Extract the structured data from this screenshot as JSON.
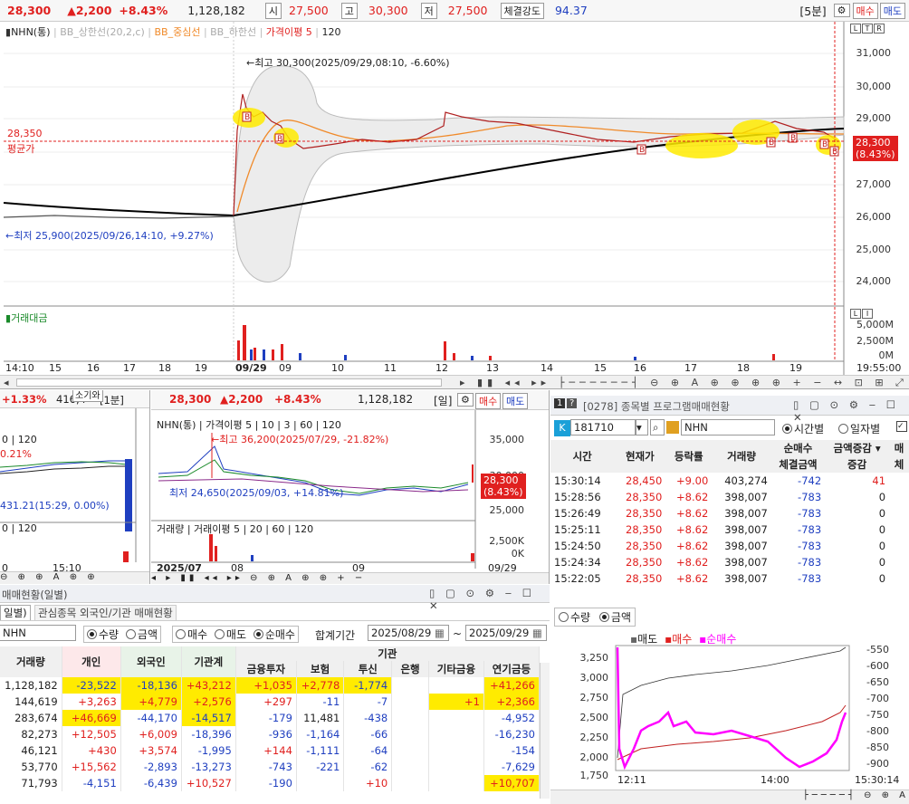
{
  "top": {
    "price": "28,300",
    "change": "▲2,200",
    "change_pct": "+8.43%",
    "volume": "1,128,182",
    "open_label": "시",
    "open": "27,500",
    "high_label": "고",
    "high": "30,300",
    "low_label": "저",
    "low": "27,500",
    "strength_label": "체결강도",
    "strength": "94.37",
    "interval": "[5분]",
    "buy": "매수",
    "sell": "매도",
    "legend": {
      "name": "NHN(통)",
      "bb_up": "BB_상한선(20,2,c)",
      "bb_mid": "BB_중심선",
      "bb_low": "BB_하한선",
      "disp": "가격이평 5",
      "n120": "120"
    },
    "max_note": "←최고 30,300(2025/09/29,08:10, -6.60%)",
    "min_note": "←최저 25,900(2025/09/26,14:10, +9.27%)",
    "avg_price": "28,350",
    "avg_label": "평균가",
    "price_tag": "28,300",
    "price_tag_pct": "(8.43%)",
    "y_ticks": [
      "31,000",
      "30,000",
      "29,000",
      "28,000",
      "27,000",
      "26,000",
      "25,000",
      "24,000"
    ],
    "vol_label": "거래대금",
    "vol_ticks": [
      "5,000M",
      "2,500M",
      "0M"
    ],
    "x_ticks": [
      "14:10",
      "15",
      "16",
      "17",
      "18",
      "19",
      "09/29",
      "09",
      "10",
      "11",
      "12",
      "13",
      "14",
      "15",
      "16",
      "17",
      "18",
      "19"
    ],
    "time": "19:55:00"
  },
  "left_mini": {
    "pct": "+1.33%",
    "val": "416,4",
    "interval": "[1분]",
    "legend": "0 | 120",
    "note": "431.21(15:29, 0.00%)",
    "legend2": "0 | 120",
    "x1": "0",
    "x2": "15:10",
    "cap": "소기와",
    "pct2": "0.21%"
  },
  "mid": {
    "price": "28,300",
    "change": "▲2,200",
    "change_pct": "+8.43%",
    "volume": "1,128,182",
    "interval": "[일]",
    "buy": "매수",
    "sell": "매도",
    "legend": "NHN(통) | 가격이평 5 | 10 | 3 | 60 | 120",
    "max_note": "←최고 36,200(2025/07/29, -21.82%)",
    "min_note": "최저 24,650(2025/09/03, +14.81%)",
    "y_ticks": [
      "35,000",
      "30,000",
      "25,000"
    ],
    "tag": "28,300",
    "tag_pct": "(8.43%)",
    "vol_legend": "거래량 | 거래이평 5 | 20 | 60 | 120",
    "vol_ticks": [
      "2,500K",
      "0K"
    ],
    "x_ticks": [
      "2025/07",
      "08",
      "09",
      "09/29"
    ]
  },
  "prog": {
    "title": "[0278] 종목별 프로그램매매현황",
    "code": "181710",
    "name": "NHN",
    "radio_time": "시간별",
    "radio_day": "일자별",
    "headers": {
      "time": "시간",
      "price": "현재가",
      "rate": "등락률",
      "vol": "거래량",
      "net": "순매수",
      "combo": "금액증감",
      "exec": "체결금액",
      "delta": "증감",
      "extra1": "매",
      "extra2": "체"
    },
    "rows": [
      [
        "15:30:14",
        "28,450",
        "+9.00",
        "403,274",
        "-742",
        "41"
      ],
      [
        "15:28:56",
        "28,350",
        "+8.62",
        "398,007",
        "-783",
        "0"
      ],
      [
        "15:26:49",
        "28,350",
        "+8.62",
        "398,007",
        "-783",
        "0"
      ],
      [
        "15:25:11",
        "28,350",
        "+8.62",
        "398,007",
        "-783",
        "0"
      ],
      [
        "15:24:50",
        "28,350",
        "+8.62",
        "398,007",
        "-783",
        "0"
      ],
      [
        "15:24:34",
        "28,350",
        "+8.62",
        "398,007",
        "-783",
        "0"
      ],
      [
        "15:22:05",
        "28,350",
        "+8.62",
        "398,007",
        "-783",
        "0"
      ]
    ],
    "radio_qty": "수량",
    "radio_amt": "금액",
    "chart_legend": {
      "sell": "매도",
      "buy": "매수",
      "net": "순매수"
    },
    "y_left": [
      "3,250",
      "3,000",
      "2,750",
      "2,500",
      "2,250",
      "2,000",
      "1,750"
    ],
    "y_right": [
      "-550",
      "-600",
      "-650",
      "-700",
      "-750",
      "-800",
      "-850",
      "-900"
    ],
    "x_ticks": [
      "12:11",
      "14:00",
      "15:30:14"
    ]
  },
  "daily": {
    "title": "매매현황(일별)",
    "tab1": "일별)",
    "tab2": "관심종목 외국인/기관 매매현황",
    "name": "NHN",
    "r_qty": "수량",
    "r_amt": "금액",
    "r_buy": "매수",
    "r_sell": "매도",
    "r_net": "순매수",
    "period_label": "합계기간",
    "from": "2025/08/29",
    "tilde": "~",
    "to": "2025/09/29",
    "inst_label": "기관",
    "headers": [
      "거래량",
      "개인",
      "외국인",
      "기관계",
      "금융투자",
      "보험",
      "투신",
      "은행",
      "기타금융",
      "연기금등"
    ],
    "rows": [
      [
        "1,128,182",
        "-23,522",
        "-18,136",
        "+43,212",
        "+1,035",
        "+2,778",
        "-1,774",
        "",
        "",
        "+41,266"
      ],
      [
        "144,619",
        "+3,263",
        "+4,779",
        "+2,576",
        "+297",
        "-11",
        "-7",
        "",
        "+1",
        "+2,366"
      ],
      [
        "283,674",
        "+46,669",
        "-44,170",
        "-14,517",
        "-179",
        "11,481",
        "-438",
        "",
        "",
        "-4,952"
      ],
      [
        "82,273",
        "+12,505",
        "+6,009",
        "-18,396",
        "-936",
        "-1,164",
        "-66",
        "",
        "",
        "-16,230"
      ],
      [
        "46,121",
        "+430",
        "+3,574",
        "-1,995",
        "+144",
        "-1,111",
        "-64",
        "",
        "",
        "-154"
      ],
      [
        "53,770",
        "+15,562",
        "-2,893",
        "-13,273",
        "-743",
        "-221",
        "-62",
        "",
        "",
        "-7,629"
      ],
      [
        "71,793",
        "-4,151",
        "-6,439",
        "+10,527",
        "-190",
        "",
        "+10",
        "",
        "",
        "+10,707"
      ]
    ]
  },
  "colors": {
    "red": "#e0201f",
    "blue": "#1f3fc0",
    "highlight": "#ffeb00",
    "magenta": "#ff00ff"
  }
}
